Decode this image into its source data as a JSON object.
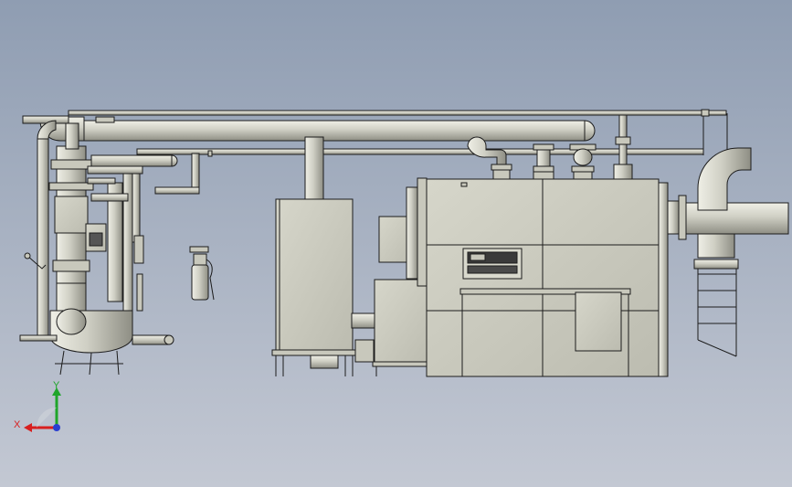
{
  "viewport": {
    "background_top": "#8f9db2",
    "background_bottom": "#c3c8d3"
  },
  "model": {
    "body_color": "#c8c8bc",
    "shade_color": "#a9a99d",
    "light_color": "#e2e2d8",
    "edge_color": "#1c1c1c",
    "components": [
      "overhead-pipe-rack",
      "vertical-vessel-assembly",
      "horizontal-tank",
      "fire-extinguisher",
      "control-cabinet",
      "generator-enclosure",
      "control-panel",
      "motor-unit",
      "exhaust-duct-elbow",
      "exhaust-ladder",
      "flange-valves"
    ]
  },
  "triad": {
    "x_label": "X",
    "y_label": "Y",
    "x_color": "#d81f1f",
    "y_color": "#1fa52a",
    "z_color": "#2a3fd0"
  }
}
